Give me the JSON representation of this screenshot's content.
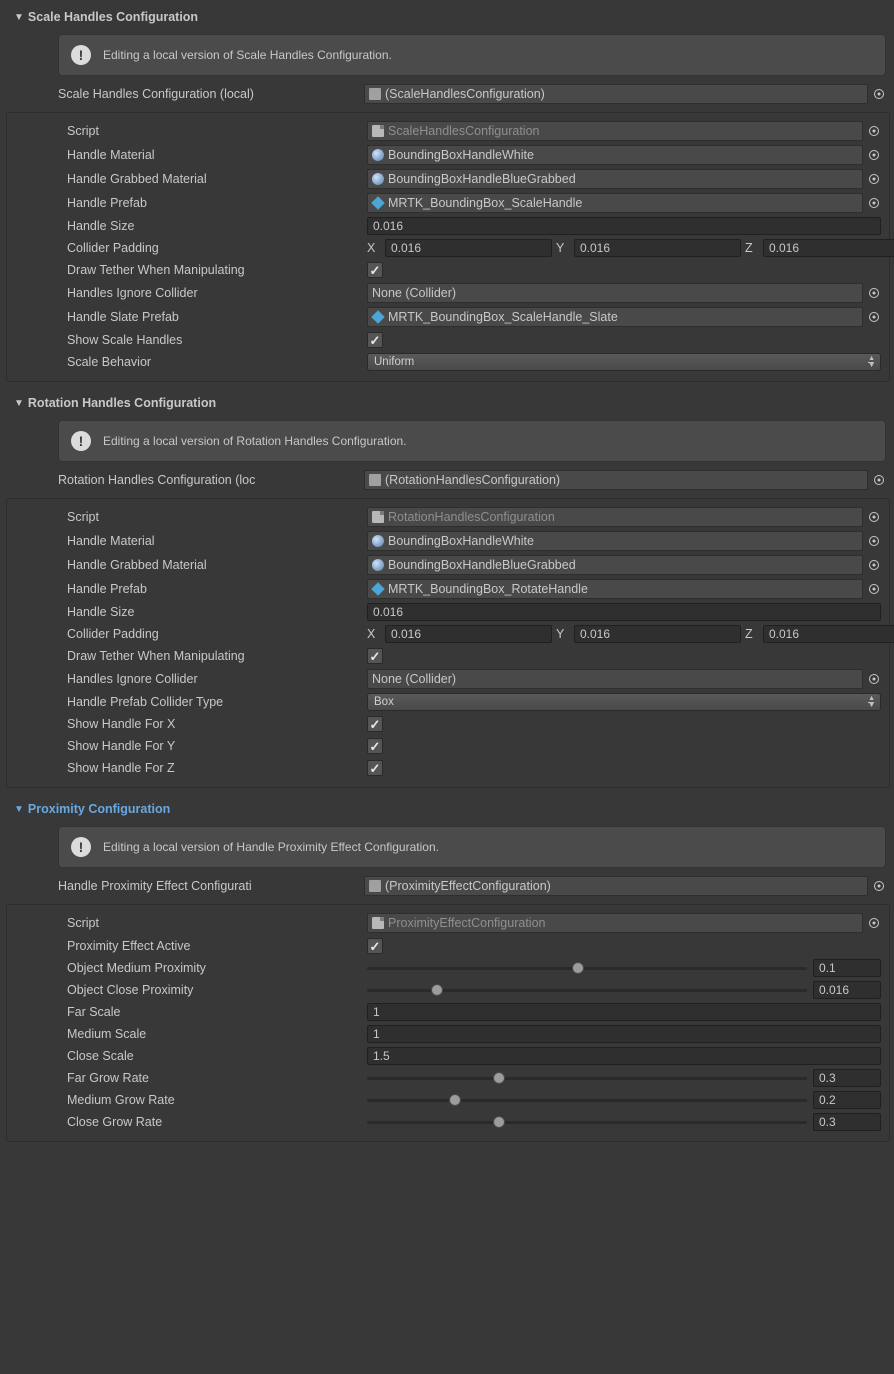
{
  "scale": {
    "header": "Scale Handles Configuration",
    "info": "Editing a local version of Scale Handles Configuration.",
    "slotLabel": "Scale Handles Configuration (local)",
    "slotValue": "(ScaleHandlesConfiguration)",
    "fields": {
      "scriptLabel": "Script",
      "scriptValue": "ScaleHandlesConfiguration",
      "handleMaterialLabel": "Handle Material",
      "handleMaterialValue": "BoundingBoxHandleWhite",
      "handleGrabbedMaterialLabel": "Handle Grabbed Material",
      "handleGrabbedMaterialValue": "BoundingBoxHandleBlueGrabbed",
      "handlePrefabLabel": "Handle Prefab",
      "handlePrefabValue": "MRTK_BoundingBox_ScaleHandle",
      "handleSizeLabel": "Handle Size",
      "handleSizeValue": "0.016",
      "colliderPaddingLabel": "Collider Padding",
      "colliderPaddingX": "0.016",
      "colliderPaddingY": "0.016",
      "colliderPaddingZ": "0.016",
      "drawTetherLabel": "Draw Tether When Manipulating",
      "handlesIgnoreColliderLabel": "Handles Ignore Collider",
      "handlesIgnoreColliderValue": "None (Collider)",
      "handleSlatePrefabLabel": "Handle Slate Prefab",
      "handleSlatePrefabValue": "MRTK_BoundingBox_ScaleHandle_Slate",
      "showScaleHandlesLabel": "Show Scale Handles",
      "scaleBehaviorLabel": "Scale Behavior",
      "scaleBehaviorValue": "Uniform"
    }
  },
  "rotation": {
    "header": "Rotation Handles Configuration",
    "info": "Editing a local version of Rotation Handles Configuration.",
    "slotLabel": "Rotation Handles Configuration (loc",
    "slotValue": "(RotationHandlesConfiguration)",
    "fields": {
      "scriptLabel": "Script",
      "scriptValue": "RotationHandlesConfiguration",
      "handleMaterialLabel": "Handle Material",
      "handleMaterialValue": "BoundingBoxHandleWhite",
      "handleGrabbedMaterialLabel": "Handle Grabbed Material",
      "handleGrabbedMaterialValue": "BoundingBoxHandleBlueGrabbed",
      "handlePrefabLabel": "Handle Prefab",
      "handlePrefabValue": "MRTK_BoundingBox_RotateHandle",
      "handleSizeLabel": "Handle Size",
      "handleSizeValue": "0.016",
      "colliderPaddingLabel": "Collider Padding",
      "colliderPaddingX": "0.016",
      "colliderPaddingY": "0.016",
      "colliderPaddingZ": "0.016",
      "drawTetherLabel": "Draw Tether When Manipulating",
      "handlesIgnoreColliderLabel": "Handles Ignore Collider",
      "handlesIgnoreColliderValue": "None (Collider)",
      "handlePrefabColliderTypeLabel": "Handle Prefab Collider Type",
      "handlePrefabColliderTypeValue": "Box",
      "showHandleXLabel": "Show Handle For X",
      "showHandleYLabel": "Show Handle For Y",
      "showHandleZLabel": "Show Handle For Z"
    }
  },
  "proximity": {
    "header": "Proximity Configuration",
    "info": "Editing a local version of Handle Proximity Effect Configuration.",
    "slotLabel": "Handle Proximity Effect Configurati",
    "slotValue": "(ProximityEffectConfiguration)",
    "fields": {
      "scriptLabel": "Script",
      "scriptValue": "ProximityEffectConfiguration",
      "proximityEffectActiveLabel": "Proximity Effect Active",
      "objectMediumProximityLabel": "Object Medium Proximity",
      "objectMediumProximityValue": "0.1",
      "objectCloseProximityLabel": "Object Close Proximity",
      "objectCloseProximityValue": "0.016",
      "farScaleLabel": "Far Scale",
      "farScaleValue": "1",
      "mediumScaleLabel": "Medium Scale",
      "mediumScaleValue": "1",
      "closeScaleLabel": "Close Scale",
      "closeScaleValue": "1.5",
      "farGrowRateLabel": "Far Grow Rate",
      "farGrowRateValue": "0.3",
      "mediumGrowRateLabel": "Medium Grow Rate",
      "mediumGrowRateValue": "0.2",
      "closeGrowRateLabel": "Close Grow Rate",
      "closeGrowRateValue": "0.3"
    }
  },
  "vec": {
    "x": "X",
    "y": "Y",
    "z": "Z"
  },
  "sliders": {
    "objectMediumProximityPos": "48%",
    "objectCloseProximityPos": "16%",
    "farGrowRatePos": "30%",
    "mediumGrowRatePos": "20%",
    "closeGrowRatePos": "30%"
  }
}
